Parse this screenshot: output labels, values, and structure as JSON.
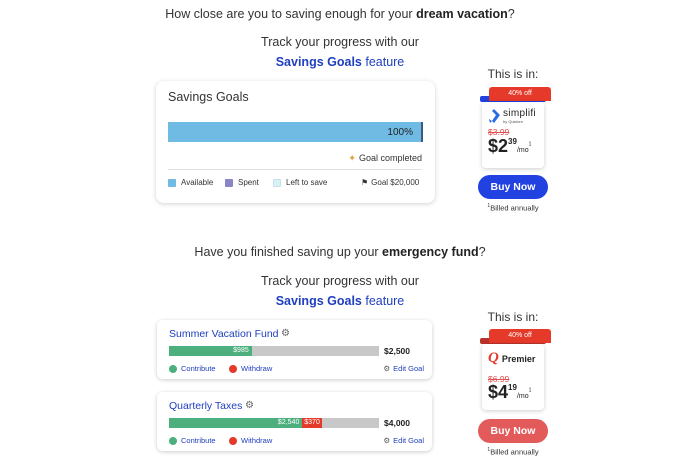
{
  "section1": {
    "question_pre": "How close are you to saving enough for your ",
    "question_bold": "dream vacation",
    "question_post": "?",
    "track_text": "Track your progress with our",
    "feature_name": "Savings Goals",
    "feature_suffix": " feature",
    "card": {
      "title": "Savings Goals",
      "progress_percent": 100,
      "progress_label": "100%",
      "status": "Goal completed",
      "status_icon": "party-popper-icon",
      "legend": [
        {
          "label": "Available",
          "color": "#6fbbe4"
        },
        {
          "label": "Spent",
          "color": "#8a86c6"
        },
        {
          "label": "Left to save",
          "color": "#d6f2f2"
        }
      ],
      "goal_label": "Goal $20,000",
      "goal_icon": "flag-icon"
    },
    "promo": {
      "title": "This is in:",
      "badge": "40% off",
      "brand": "simplifi",
      "brand_sub": "by Quicken",
      "old_price": "$3.99",
      "price_dollars": "$2",
      "price_cents": "39",
      "price_unit": "/mo",
      "price_footnote_mark": "1",
      "button": "Buy Now",
      "billed_mark": "1",
      "billed": "Billed annually",
      "accent": "#2141e0"
    }
  },
  "section2": {
    "question_pre": "Have you finished saving up your ",
    "question_bold": "emergency fund",
    "question_post": "?",
    "track_text": "Track your progress with our",
    "feature_name": "Savings Goals",
    "feature_suffix": " feature",
    "goals": [
      {
        "name": "Summer Vacation Fund",
        "saved_label": "$985",
        "saved_fraction": 0.394,
        "spent_label": "",
        "spent_fraction": 0,
        "total": "$2,500",
        "contribute": "Contribute",
        "withdraw": "Withdraw",
        "edit": "Edit Goal"
      },
      {
        "name": "Quarterly Taxes",
        "saved_label": "$2,540",
        "saved_fraction": 0.635,
        "spent_label": "$370",
        "spent_fraction": 0.0925,
        "total": "$4,000",
        "contribute": "Contribute",
        "withdraw": "Withdraw",
        "edit": "Edit Goal"
      }
    ],
    "promo": {
      "title": "This is in:",
      "badge": "40% off",
      "brand": "Premier",
      "brand_logo_letter": "Q",
      "old_price": "$6.99",
      "price_dollars": "$4",
      "price_cents": "19",
      "price_unit": "/mo",
      "price_footnote_mark": "1",
      "button": "Buy Now",
      "billed_mark": "1",
      "billed": "Billed annually",
      "accent": "#e25a5a"
    }
  },
  "colors": {
    "saved": "#4caf7d",
    "spent": "#e53a2a",
    "remaining": "#c8c8c8",
    "link": "#1f3fbf",
    "contribute_dot": "#4caf7d",
    "withdraw_dot": "#e53a2a"
  }
}
